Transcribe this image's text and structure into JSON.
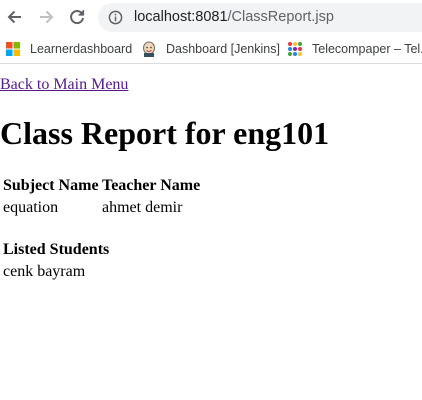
{
  "browser": {
    "url_host": "localhost:8081",
    "url_path": "/ClassReport.jsp",
    "bookmarks": [
      {
        "label": "Learnerdashboard",
        "icon": "microsoft-icon"
      },
      {
        "label": "Dashboard [Jenkins]",
        "icon": "jenkins-icon"
      },
      {
        "label": "Telecompaper – Tel...",
        "icon": "telecompaper-icon"
      }
    ]
  },
  "page": {
    "back_link": "Back to Main Menu",
    "title": "Class Report for eng101",
    "table": {
      "headers": [
        "Subject Name",
        "Teacher Name"
      ],
      "rows": [
        [
          "equation",
          "ahmet demir"
        ]
      ]
    },
    "students_heading": "Listed Students",
    "students": [
      "cenk bayram"
    ]
  }
}
